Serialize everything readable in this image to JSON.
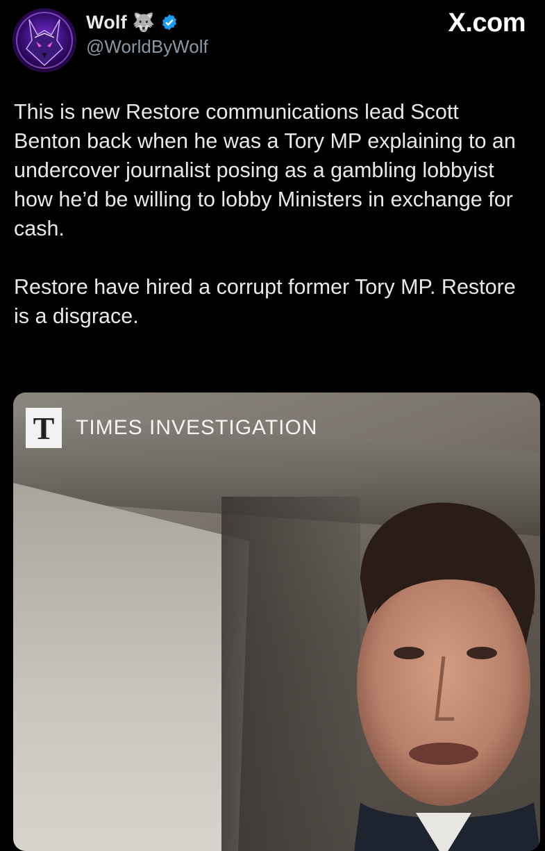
{
  "author": {
    "display_name": "Wolf",
    "emoji": "🐺",
    "handle": "@WorldByWolf",
    "avatar_icon": "wolf-avatar",
    "verified_icon": "verified-badge-icon"
  },
  "site_logo": "X.com",
  "post": {
    "paragraphs": [
      "This is new Restore communications lead Scott Benton back when he was a Tory MP explaining to an undercover journalist posing as a gambling lobbyist how he’d be willing to lobby Ministers in exchange for cash.",
      "Restore have hired a corrupt former Tory MP. Restore is a disgrace."
    ]
  },
  "media": {
    "logo_letter": "T",
    "watermark_text": "TIMES INVESTIGATION"
  },
  "colors": {
    "background": "#000000",
    "text": "#e7e9ea",
    "handle": "#8b98a5",
    "verified": "#1d9bf0"
  }
}
